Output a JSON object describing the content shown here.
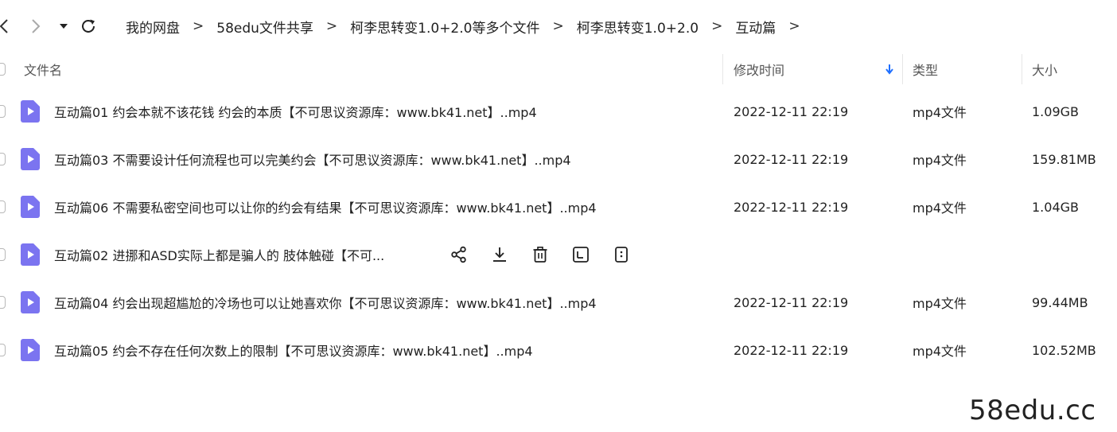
{
  "breadcrumb": [
    {
      "label": "我的网盘"
    },
    {
      "label": "58edu文件共享"
    },
    {
      "label": "柯李思转变1.0+2.0等多个文件"
    },
    {
      "label": "柯李思转变1.0+2.0"
    },
    {
      "label": "互动篇"
    }
  ],
  "breadcrumb_separator": ">",
  "columns": {
    "name": "文件名",
    "modified": "修改时间",
    "type": "类型",
    "size": "大小"
  },
  "files": [
    {
      "name": "互动篇01 约会本就不该花钱 约会的本质【不可思议资源库：www.bk41.net】..mp4",
      "modified": "2022-12-11 22:19",
      "type": "mp4文件",
      "size": "1.09GB"
    },
    {
      "name": "互动篇03 不需要设计任何流程也可以完美约会【不可思议资源库：www.bk41.net】..mp4",
      "modified": "2022-12-11 22:19",
      "type": "mp4文件",
      "size": "159.81MB"
    },
    {
      "name": "互动篇06 不需要私密空间也可以让你的约会有结果【不可思议资源库：www.bk41.net】..mp4",
      "modified": "2022-12-11 22:19",
      "type": "mp4文件",
      "size": "1.04GB"
    },
    {
      "name": "互动篇02 进挪和ASD实际上都是骗人的 肢体触碰【不可...",
      "modified": "",
      "type": "",
      "size": ""
    },
    {
      "name": "互动篇04 约会出现超尴尬的冷场也可以让她喜欢你【不可思议资源库：www.bk41.net】..mp4",
      "modified": "2022-12-11 22:19",
      "type": "mp4文件",
      "size": "99.44MB"
    },
    {
      "name": "互动篇05 约会不存在任何次数上的限制【不可思议资源库：www.bk41.net】..mp4",
      "modified": "2022-12-11 22:19",
      "type": "mp4文件",
      "size": "102.52MB"
    }
  ],
  "hover_actions": [
    "share-icon",
    "download-icon",
    "delete-icon",
    "rename-icon",
    "more-icon"
  ],
  "sort_indicator": "arrow-down-icon",
  "colors": {
    "accent": "#1e6fff",
    "file_icon": "#7b74f0",
    "text": "#222222",
    "header_text": "#555555"
  },
  "watermark": "58edu.cc"
}
